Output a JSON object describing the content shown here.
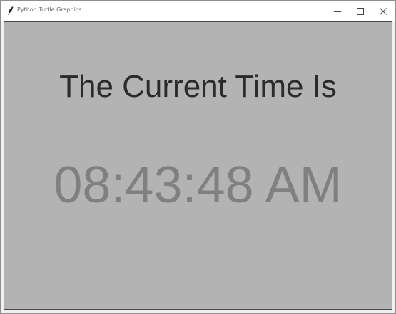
{
  "window": {
    "title": "Python Turtle Graphics",
    "icon": "feather-icon",
    "controls": [
      "minimize-icon",
      "maximize-icon",
      "close-icon"
    ]
  },
  "canvas": {
    "background_color": "#b3b3b3",
    "heading": "The Current Time Is",
    "heading_color": "#2b2b2b",
    "time": "08:43:48 AM",
    "time_color": "#808080"
  }
}
